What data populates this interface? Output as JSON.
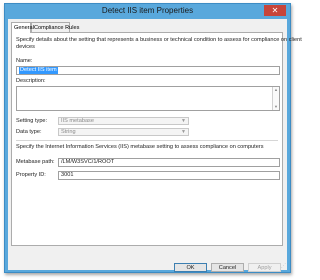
{
  "window": {
    "title": "Detect IIS item Properties",
    "close_glyph": "✕"
  },
  "tabs": [
    {
      "label": "General"
    },
    {
      "label": "Compliance Rules"
    }
  ],
  "general": {
    "intro": [
      "Specify details about the setting that represents a business or technical condition to assess for compliance on client",
      "devices"
    ],
    "name_label": "Name:",
    "name_value": "Detect IIS item",
    "description_label": "Description:",
    "description_value": "",
    "setting_type_label": "Setting type:",
    "setting_type_value": "IIS metabase",
    "data_type_label": "Data type:",
    "data_type_value": "String",
    "iis_intro": "Specify the Internet Information Services (IIS) metabase setting to assess compliance on computers",
    "metabase_path_label": "Metabase path:",
    "metabase_path_value": "/LM/W3SVC/1/ROOT",
    "property_id_label": "Property ID:",
    "property_id_value": "3001"
  },
  "buttons": {
    "ok": "OK",
    "cancel": "Cancel",
    "apply": "Apply"
  },
  "icons": {
    "dropdown": "chevron-down-icon",
    "scroll_up": "scroll-up-icon",
    "scroll_down": "scroll-down-icon"
  }
}
